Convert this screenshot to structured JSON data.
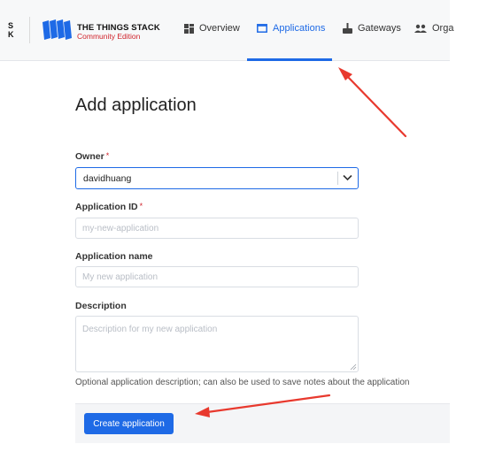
{
  "brand": {
    "short_letters": "S\nK",
    "title": "THE THINGS STACK",
    "subtitle": "Community Edition"
  },
  "nav": {
    "items": [
      {
        "label": "Overview",
        "icon": "grid-icon"
      },
      {
        "label": "Applications",
        "icon": "window-icon",
        "active": true
      },
      {
        "label": "Gateways",
        "icon": "gateway-icon"
      },
      {
        "label": "Orga",
        "icon": "people-icon"
      }
    ]
  },
  "page": {
    "title": "Add application"
  },
  "form": {
    "owner": {
      "label": "Owner",
      "required_mark": "*",
      "value": "davidhuang"
    },
    "application_id": {
      "label": "Application ID",
      "required_mark": "*",
      "placeholder": "my-new-application"
    },
    "application_name": {
      "label": "Application name",
      "placeholder": "My new application"
    },
    "description": {
      "label": "Description",
      "placeholder": "Description for my new application",
      "help": "Optional application description; can also be used to save notes about the application"
    },
    "submit_label": "Create application"
  },
  "colors": {
    "accent": "#1e6ae6",
    "brand_red": "#d0232b",
    "annotation_arrow": "#e8392e"
  }
}
